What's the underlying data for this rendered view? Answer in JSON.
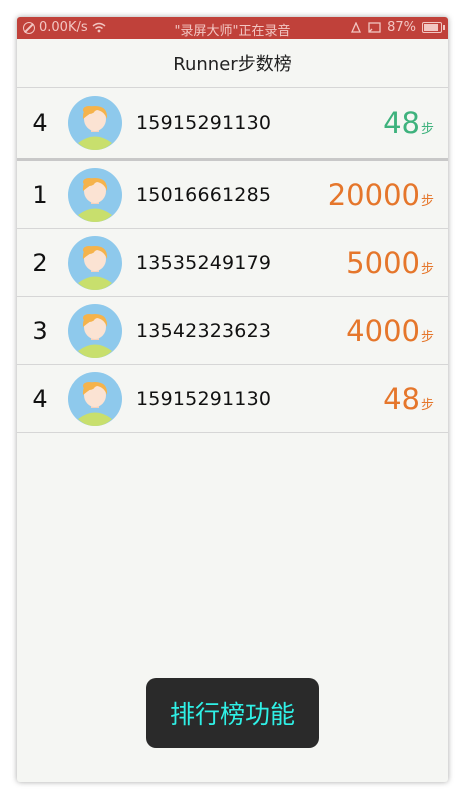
{
  "status_bar": {
    "speed": "0.00K/s",
    "recording": "\"录屏大师\"正在录音",
    "battery": "87%"
  },
  "header": {
    "title": "Runner步数榜"
  },
  "my_rank": {
    "rank": "4",
    "phone": "15915291130",
    "steps": "48",
    "unit": "步"
  },
  "ranking": [
    {
      "rank": "1",
      "phone": "15016661285",
      "steps": "20000",
      "unit": "步"
    },
    {
      "rank": "2",
      "phone": "13535249179",
      "steps": "5000",
      "unit": "步"
    },
    {
      "rank": "3",
      "phone": "13542323623",
      "steps": "4000",
      "unit": "步"
    },
    {
      "rank": "4",
      "phone": "15915291130",
      "steps": "48",
      "unit": "步"
    }
  ],
  "toast": {
    "text": "排行榜功能"
  },
  "colors": {
    "status_bar": "#c0413a",
    "steps_others": "#e5762b",
    "steps_mine": "#3eb27d",
    "toast_text": "#2ff0e6"
  },
  "icons": {
    "avatar": "user-avatar-icon",
    "wifi": "wifi-icon",
    "battery": "battery-icon"
  }
}
